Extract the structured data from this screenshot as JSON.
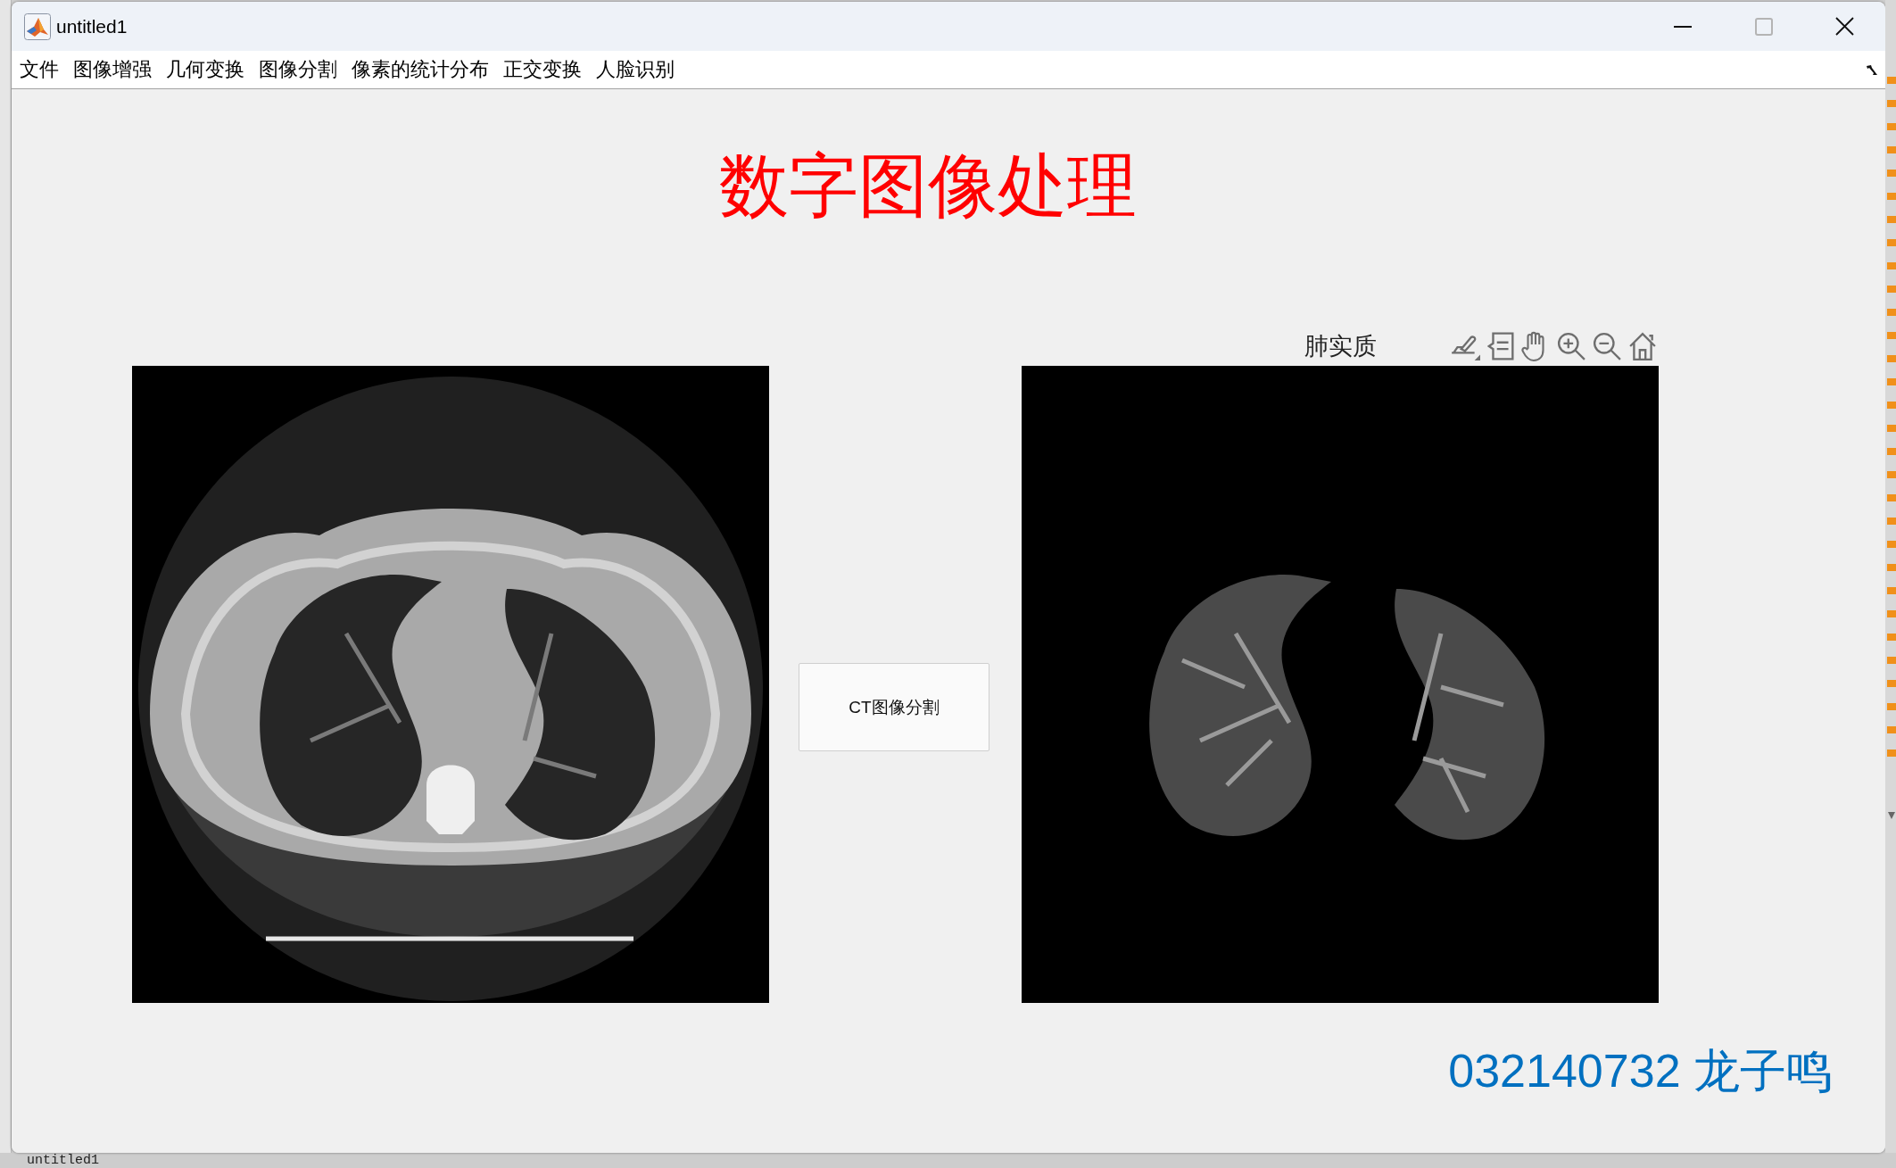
{
  "window": {
    "title": "untitled1"
  },
  "window_controls": [
    {
      "kind": "minimize",
      "disabled": false
    },
    {
      "kind": "maximize",
      "disabled": true
    },
    {
      "kind": "close",
      "disabled": false
    }
  ],
  "menu_bar": {
    "items": [
      {
        "label": "文件"
      },
      {
        "label": "图像增强"
      },
      {
        "label": "几何变换"
      },
      {
        "label": "图像分割"
      },
      {
        "label": "像素的统计分布"
      },
      {
        "label": "正交变换"
      },
      {
        "label": "人脸识别"
      }
    ]
  },
  "heading": "数字图像处理",
  "segment_button": {
    "label": "CT图像分割"
  },
  "result_axes": {
    "title": "肺实质"
  },
  "footer_label": "032140732 龙子鸣",
  "editor_behind": {
    "tab_label": "untitled1"
  }
}
